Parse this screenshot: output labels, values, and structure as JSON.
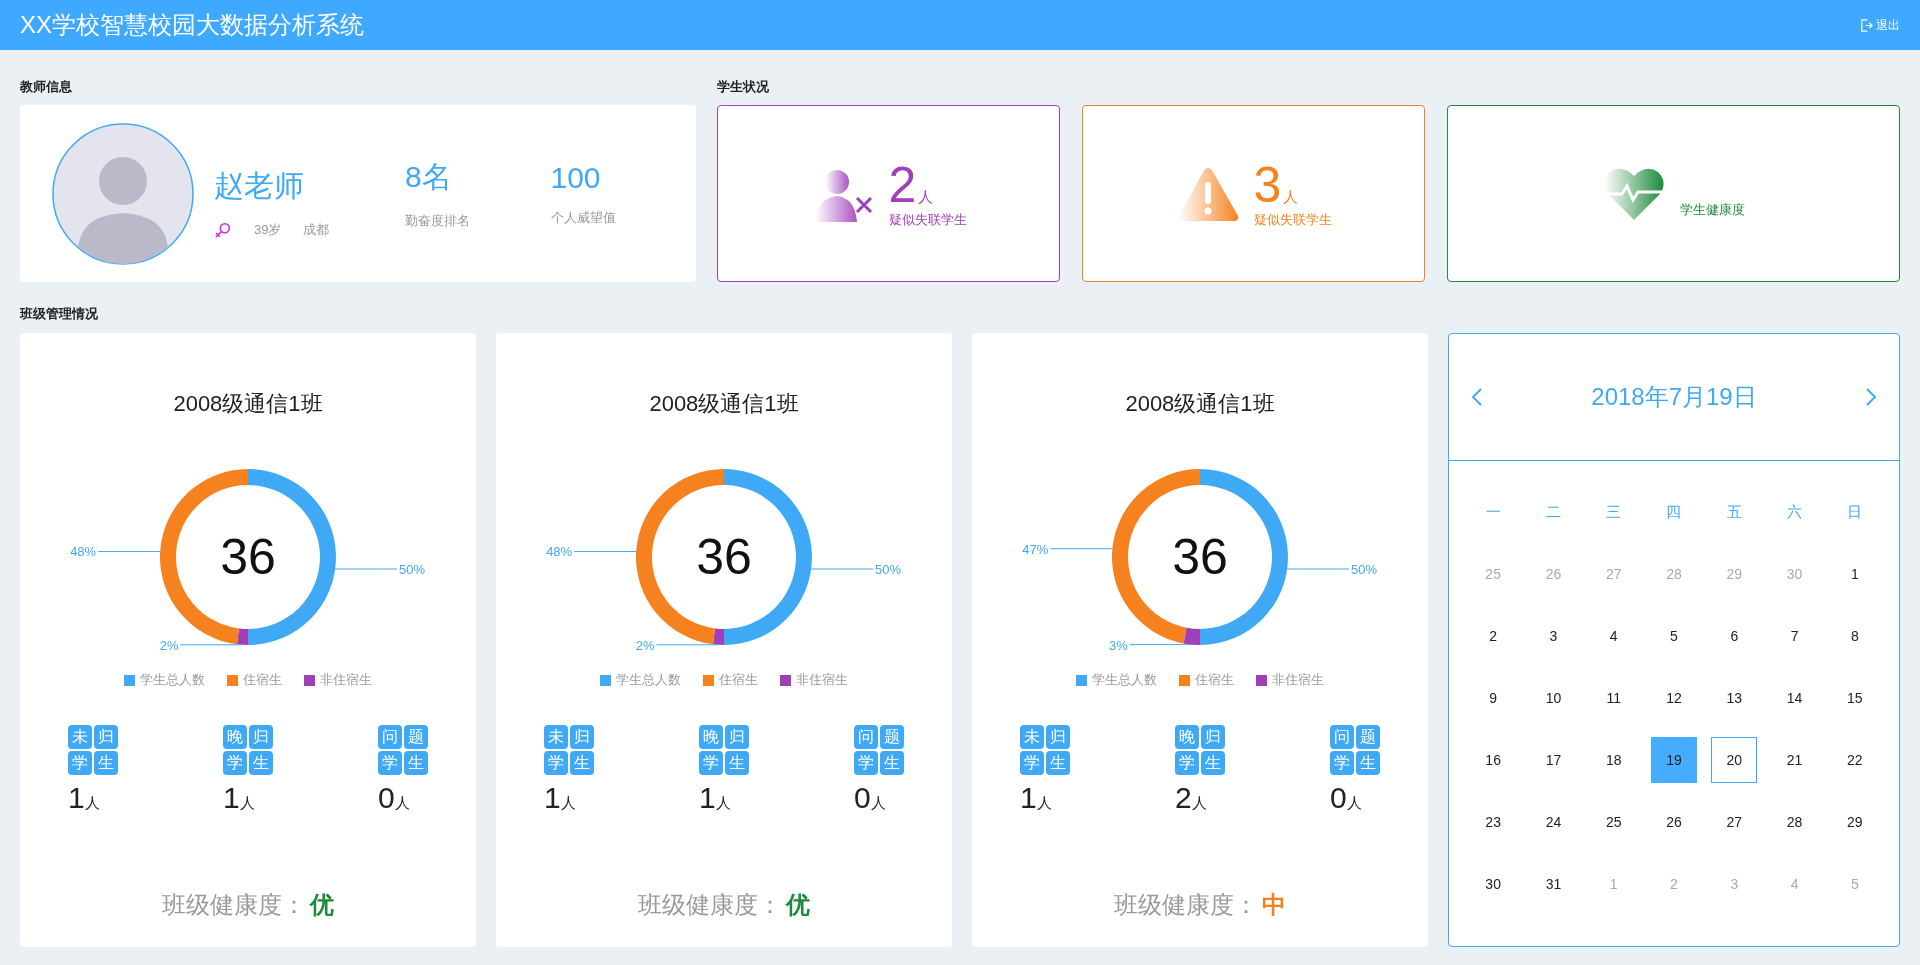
{
  "header": {
    "title": "XX学校智慧校园大数据分析系统",
    "exit_label": "退出"
  },
  "teacher_section": {
    "title": "教师信息",
    "name": "赵老师",
    "age": "39岁",
    "city": "成都",
    "stats": [
      {
        "value": "8名",
        "label": "勤奋度排名"
      },
      {
        "value": "100",
        "label": "个人威望值"
      }
    ]
  },
  "student_section": {
    "title": "学生状况",
    "items": [
      {
        "kind": "lost",
        "count": "2",
        "unit": "人",
        "label": "疑似失联学生",
        "color": "#a040b8"
      },
      {
        "kind": "warning",
        "count": "3",
        "unit": "人",
        "label": "疑似失联学生",
        "color": "#f5821f"
      },
      {
        "kind": "health",
        "label": "学生健康度",
        "color": "#1e8a3c"
      }
    ]
  },
  "class_section": {
    "title": "班级管理情况",
    "classes": [
      {
        "name": "2008级通信1班",
        "total": "36",
        "chart_data": {
          "type": "donut",
          "categories": [
            "学生总人数",
            "住宿生",
            "非住宿生"
          ],
          "values": [
            50,
            48,
            2
          ],
          "value_labels": [
            "50%",
            "48%",
            "2%"
          ]
        },
        "stats": [
          {
            "label": "未归学生",
            "value": "1",
            "unit": "人"
          },
          {
            "label": "晚归学生",
            "value": "1",
            "unit": "人"
          },
          {
            "label": "问题学生",
            "value": "0",
            "unit": "人"
          }
        ],
        "health_label": "班级健康度：",
        "health": "优",
        "color": "#1e8a3c"
      },
      {
        "name": "2008级通信1班",
        "total": "36",
        "chart_data": {
          "type": "donut",
          "categories": [
            "学生总人数",
            "住宿生",
            "非住宿生"
          ],
          "values": [
            50,
            48,
            2
          ],
          "value_labels": [
            "50%",
            "48%",
            "2%"
          ]
        },
        "stats": [
          {
            "label": "未归学生",
            "value": "1",
            "unit": "人"
          },
          {
            "label": "晚归学生",
            "value": "1",
            "unit": "人"
          },
          {
            "label": "问题学生",
            "value": "0",
            "unit": "人"
          }
        ],
        "health_label": "班级健康度：",
        "health": "优",
        "color": "#1e8a3c"
      },
      {
        "name": "2008级通信1班",
        "total": "36",
        "chart_data": {
          "type": "donut",
          "categories": [
            "学生总人数",
            "住宿生",
            "非住宿生"
          ],
          "values": [
            50,
            47,
            3
          ],
          "value_labels": [
            "50%",
            "47%",
            "3%"
          ]
        },
        "stats": [
          {
            "label": "未归学生",
            "value": "1",
            "unit": "人"
          },
          {
            "label": "晚归学生",
            "value": "2",
            "unit": "人"
          },
          {
            "label": "问题学生",
            "value": "0",
            "unit": "人"
          }
        ],
        "health_label": "班级健康度：",
        "health": "中",
        "color": "#f5821f"
      }
    ]
  },
  "calendar": {
    "title": "2018年7月19日",
    "weekdays": [
      "一",
      "二",
      "三",
      "四",
      "五",
      "六",
      "日"
    ],
    "days": [
      {
        "day": "25",
        "in_month": false,
        "selected": false,
        "outlined": false
      },
      {
        "day": "26",
        "in_month": false,
        "selected": false,
        "outlined": false
      },
      {
        "day": "27",
        "in_month": false,
        "selected": false,
        "outlined": false
      },
      {
        "day": "28",
        "in_month": false,
        "selected": false,
        "outlined": false
      },
      {
        "day": "29",
        "in_month": false,
        "selected": false,
        "outlined": false
      },
      {
        "day": "30",
        "in_month": false,
        "selected": false,
        "outlined": false
      },
      {
        "day": "1",
        "in_month": true,
        "selected": false,
        "outlined": false
      },
      {
        "day": "2",
        "in_month": true,
        "selected": false,
        "outlined": false
      },
      {
        "day": "3",
        "in_month": true,
        "selected": false,
        "outlined": false
      },
      {
        "day": "4",
        "in_month": true,
        "selected": false,
        "outlined": false
      },
      {
        "day": "5",
        "in_month": true,
        "selected": false,
        "outlined": false
      },
      {
        "day": "6",
        "in_month": true,
        "selected": false,
        "outlined": false
      },
      {
        "day": "7",
        "in_month": true,
        "selected": false,
        "outlined": false
      },
      {
        "day": "8",
        "in_month": true,
        "selected": false,
        "outlined": false
      },
      {
        "day": "9",
        "in_month": true,
        "selected": false,
        "outlined": false
      },
      {
        "day": "10",
        "in_month": true,
        "selected": false,
        "outlined": false
      },
      {
        "day": "11",
        "in_month": true,
        "selected": false,
        "outlined": false
      },
      {
        "day": "12",
        "in_month": true,
        "selected": false,
        "outlined": false
      },
      {
        "day": "13",
        "in_month": true,
        "selected": false,
        "outlined": false
      },
      {
        "day": "14",
        "in_month": true,
        "selected": false,
        "outlined": false
      },
      {
        "day": "15",
        "in_month": true,
        "selected": false,
        "outlined": false
      },
      {
        "day": "16",
        "in_month": true,
        "selected": false,
        "outlined": false
      },
      {
        "day": "17",
        "in_month": true,
        "selected": false,
        "outlined": false
      },
      {
        "day": "18",
        "in_month": true,
        "selected": false,
        "outlined": false
      },
      {
        "day": "19",
        "in_month": true,
        "selected": true,
        "outlined": false
      },
      {
        "day": "20",
        "in_month": true,
        "selected": false,
        "outlined": true
      },
      {
        "day": "21",
        "in_month": true,
        "selected": false,
        "outlined": false
      },
      {
        "day": "22",
        "in_month": true,
        "selected": false,
        "outlined": false
      },
      {
        "day": "23",
        "in_month": true,
        "selected": false,
        "outlined": false
      },
      {
        "day": "24",
        "in_month": true,
        "selected": false,
        "outlined": false
      },
      {
        "day": "25",
        "in_month": true,
        "selected": false,
        "outlined": false
      },
      {
        "day": "26",
        "in_month": true,
        "selected": false,
        "outlined": false
      },
      {
        "day": "27",
        "in_month": true,
        "selected": false,
        "outlined": false
      },
      {
        "day": "28",
        "in_month": true,
        "selected": false,
        "outlined": false
      },
      {
        "day": "29",
        "in_month": true,
        "selected": false,
        "outlined": false
      },
      {
        "day": "30",
        "in_month": true,
        "selected": false,
        "outlined": false
      },
      {
        "day": "31",
        "in_month": true,
        "selected": false,
        "outlined": false
      },
      {
        "day": "1",
        "in_month": false,
        "selected": false,
        "outlined": false
      },
      {
        "day": "2",
        "in_month": false,
        "selected": false,
        "outlined": false
      },
      {
        "day": "3",
        "in_month": false,
        "selected": false,
        "outlined": false
      },
      {
        "day": "4",
        "in_month": false,
        "selected": false,
        "outlined": false
      },
      {
        "day": "5",
        "in_month": false,
        "selected": false,
        "outlined": false
      }
    ]
  }
}
